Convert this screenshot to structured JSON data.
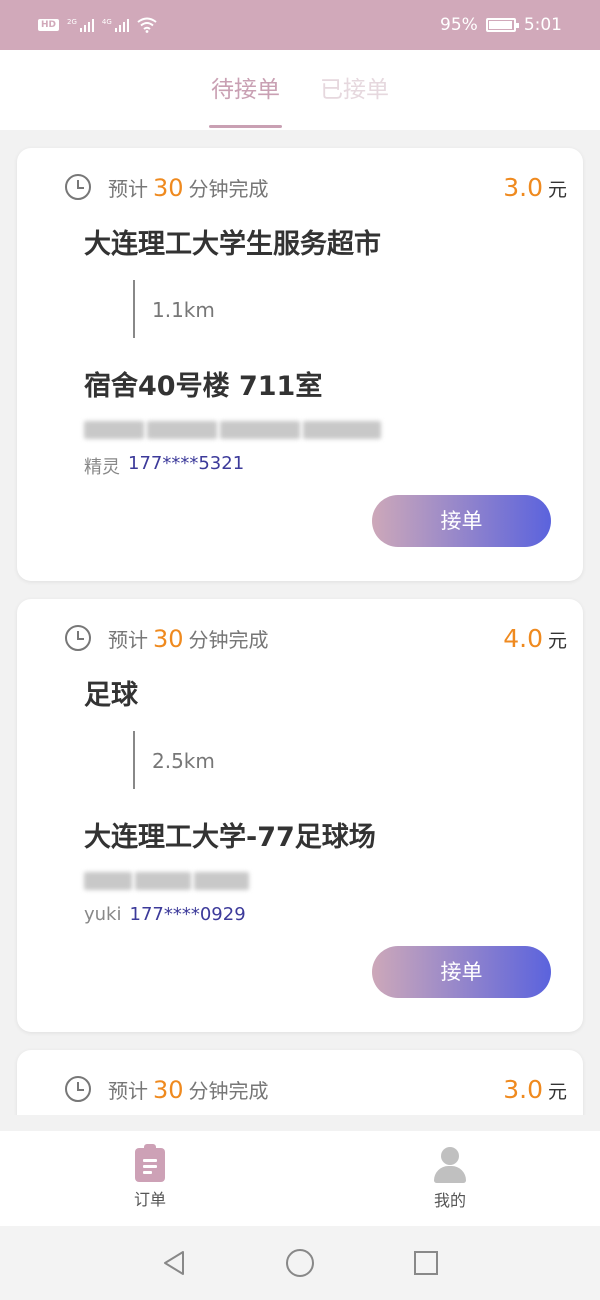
{
  "status_bar": {
    "hd_label": "HD",
    "net1": "2G",
    "net2": "4G",
    "battery_text": "95%",
    "battery_level": 0.95,
    "time": "5:01"
  },
  "tabs": [
    {
      "label": "待接单",
      "active": true
    },
    {
      "label": "已接单",
      "active": false
    }
  ],
  "orders": [
    {
      "est_prefix": "预计",
      "est_minutes": "30",
      "est_suffix": "分钟完成",
      "price": "3.0",
      "price_unit": "元",
      "from": "大连理工大学生服务超市",
      "distance": "1.1km",
      "to": "宿舍40号楼 711室",
      "contact_name": "精灵",
      "contact_phone": "177****5321",
      "accept_label": "接单"
    },
    {
      "est_prefix": "预计",
      "est_minutes": "30",
      "est_suffix": "分钟完成",
      "price": "4.0",
      "price_unit": "元",
      "from": "足球",
      "distance": "2.5km",
      "to": "大连理工大学-77足球场",
      "contact_name": "yuki",
      "contact_phone": "177****0929",
      "accept_label": "接单"
    },
    {
      "est_prefix": "预计",
      "est_minutes": "30",
      "est_suffix": "分钟完成",
      "price": "3.0",
      "price_unit": "元"
    }
  ],
  "bottom_nav": [
    {
      "label": "订单",
      "icon": "clipboard-icon",
      "active": true
    },
    {
      "label": "我的",
      "icon": "user-icon",
      "active": false
    }
  ],
  "colors": {
    "accent": "#c9a0b3",
    "price": "#ef8a1f",
    "phone": "#3c3a9a",
    "button_gradient_start": "#cda8b9",
    "button_gradient_end": "#5b63dd"
  }
}
